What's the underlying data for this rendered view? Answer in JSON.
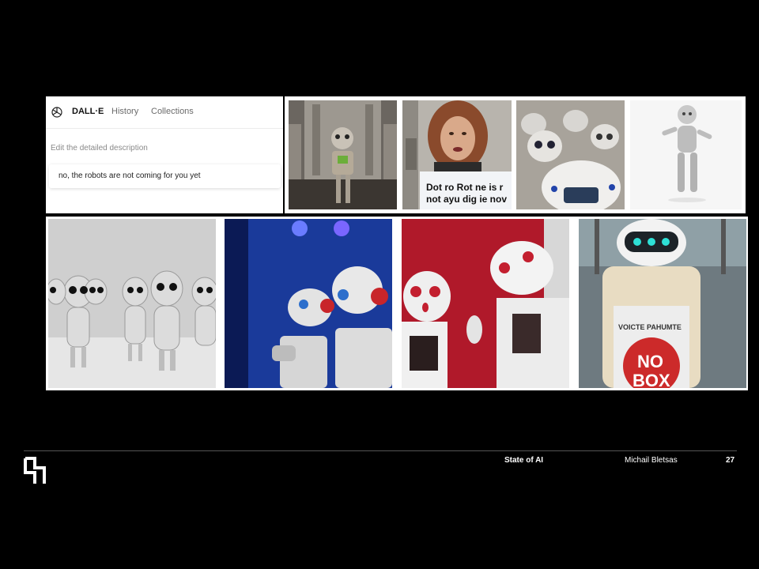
{
  "dalle_ui": {
    "brand": "DALL·E",
    "nav": [
      "History",
      "Collections"
    ],
    "edit_hint": "Edit the detailed description",
    "prompt": "no, the robots are not coming for you yet"
  },
  "images": [
    {
      "name": "robot-image-1",
      "caption": ""
    },
    {
      "name": "robot-image-2",
      "sign_line1": "Dot ro Rot ne is r",
      "sign_line2": "not ayu dig ie nov"
    },
    {
      "name": "robot-image-3"
    },
    {
      "name": "robot-image-4"
    },
    {
      "name": "robot-image-5"
    },
    {
      "name": "robot-image-6"
    },
    {
      "name": "robot-image-7"
    },
    {
      "name": "robot-image-8",
      "sign_top": "VOICTE PAHUMTE",
      "sign_big1": "NO",
      "sign_big2": "BOX"
    }
  ],
  "footer": {
    "title": "State of AI",
    "author": "Michail Bletsas",
    "page": "27"
  },
  "colors": {
    "background": "#000000",
    "panel": "#ffffff",
    "footer_rule": "#555555"
  }
}
